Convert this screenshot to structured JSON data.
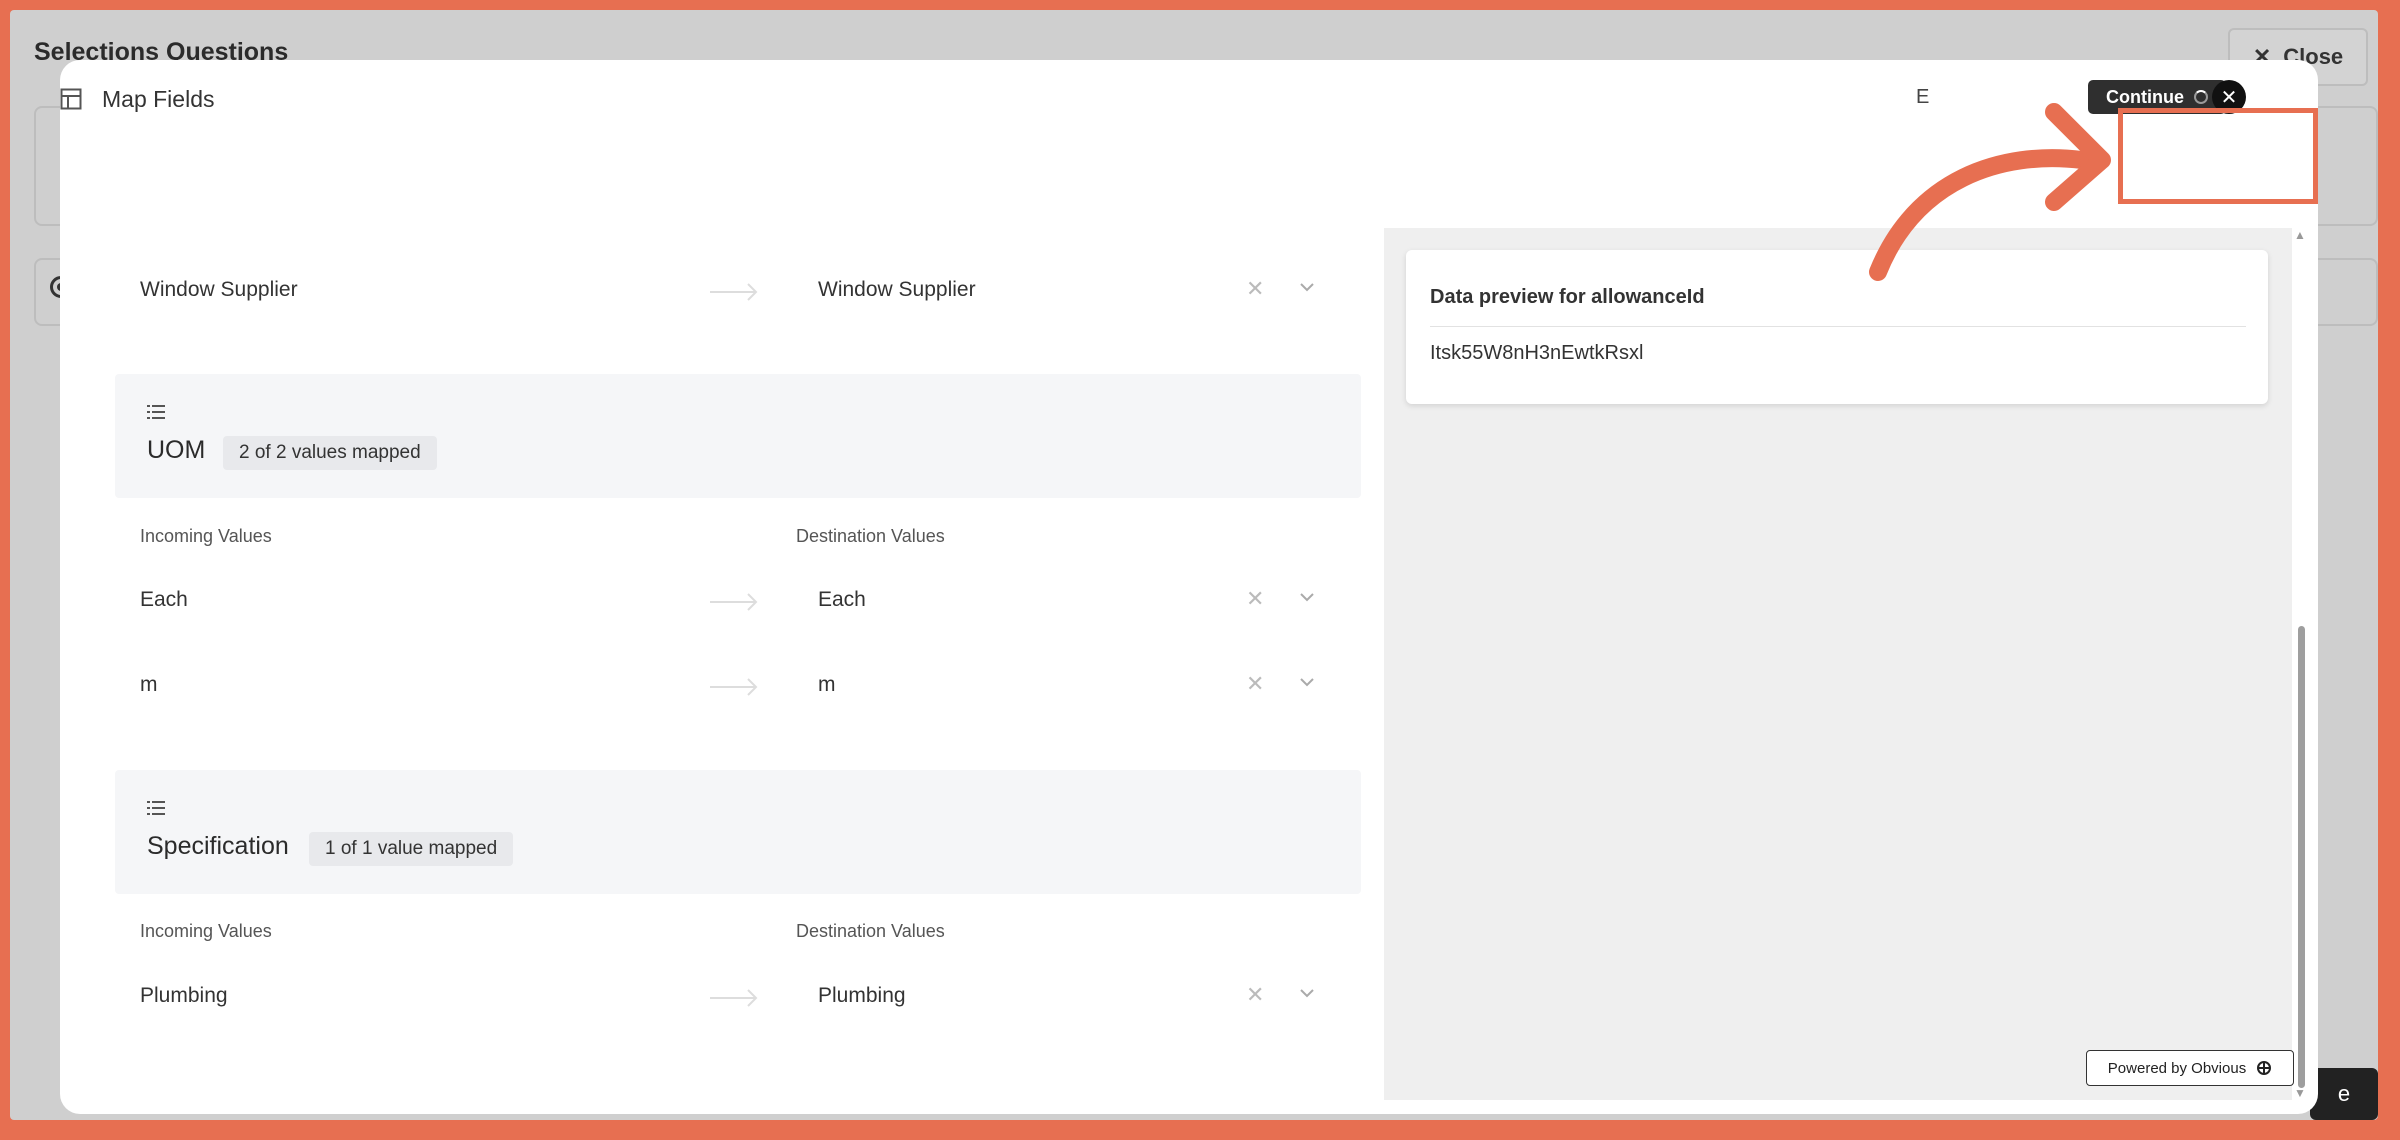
{
  "background": {
    "page_title": "Selections Questions",
    "close_label": "Close",
    "dark_button_label": "e"
  },
  "modal": {
    "title": "Map Fields",
    "hidden_action_text": "E",
    "continue_label": "Continue"
  },
  "mappings": {
    "top_row": {
      "incoming": "Window Supplier",
      "destination": "Window Supplier"
    },
    "sections": [
      {
        "name": "UOM",
        "badge": "2 of 2 values mapped",
        "incoming_label": "Incoming Values",
        "destination_label": "Destination Values",
        "rows": [
          {
            "incoming": "Each",
            "destination": "Each"
          },
          {
            "incoming": "m",
            "destination": "m"
          }
        ]
      },
      {
        "name": "Specification",
        "badge": "1 of 1 value mapped",
        "incoming_label": "Incoming Values",
        "destination_label": "Destination Values",
        "rows": [
          {
            "incoming": "Plumbing",
            "destination": "Plumbing"
          }
        ]
      }
    ]
  },
  "preview": {
    "title": "Data preview for allowanceId",
    "value": "Itsk55W8nH3nEwtkRsxl"
  },
  "footer": {
    "powered_by": "Powered by Obvious"
  },
  "colors": {
    "annotation": "#e76f51",
    "continue_bg": "#2f2f2f"
  },
  "icons": [
    "table-icon",
    "list-icon",
    "arrow-right-icon",
    "clear-icon",
    "chevron-down-icon",
    "close-icon",
    "spinner-icon",
    "obvious-logo-icon"
  ]
}
